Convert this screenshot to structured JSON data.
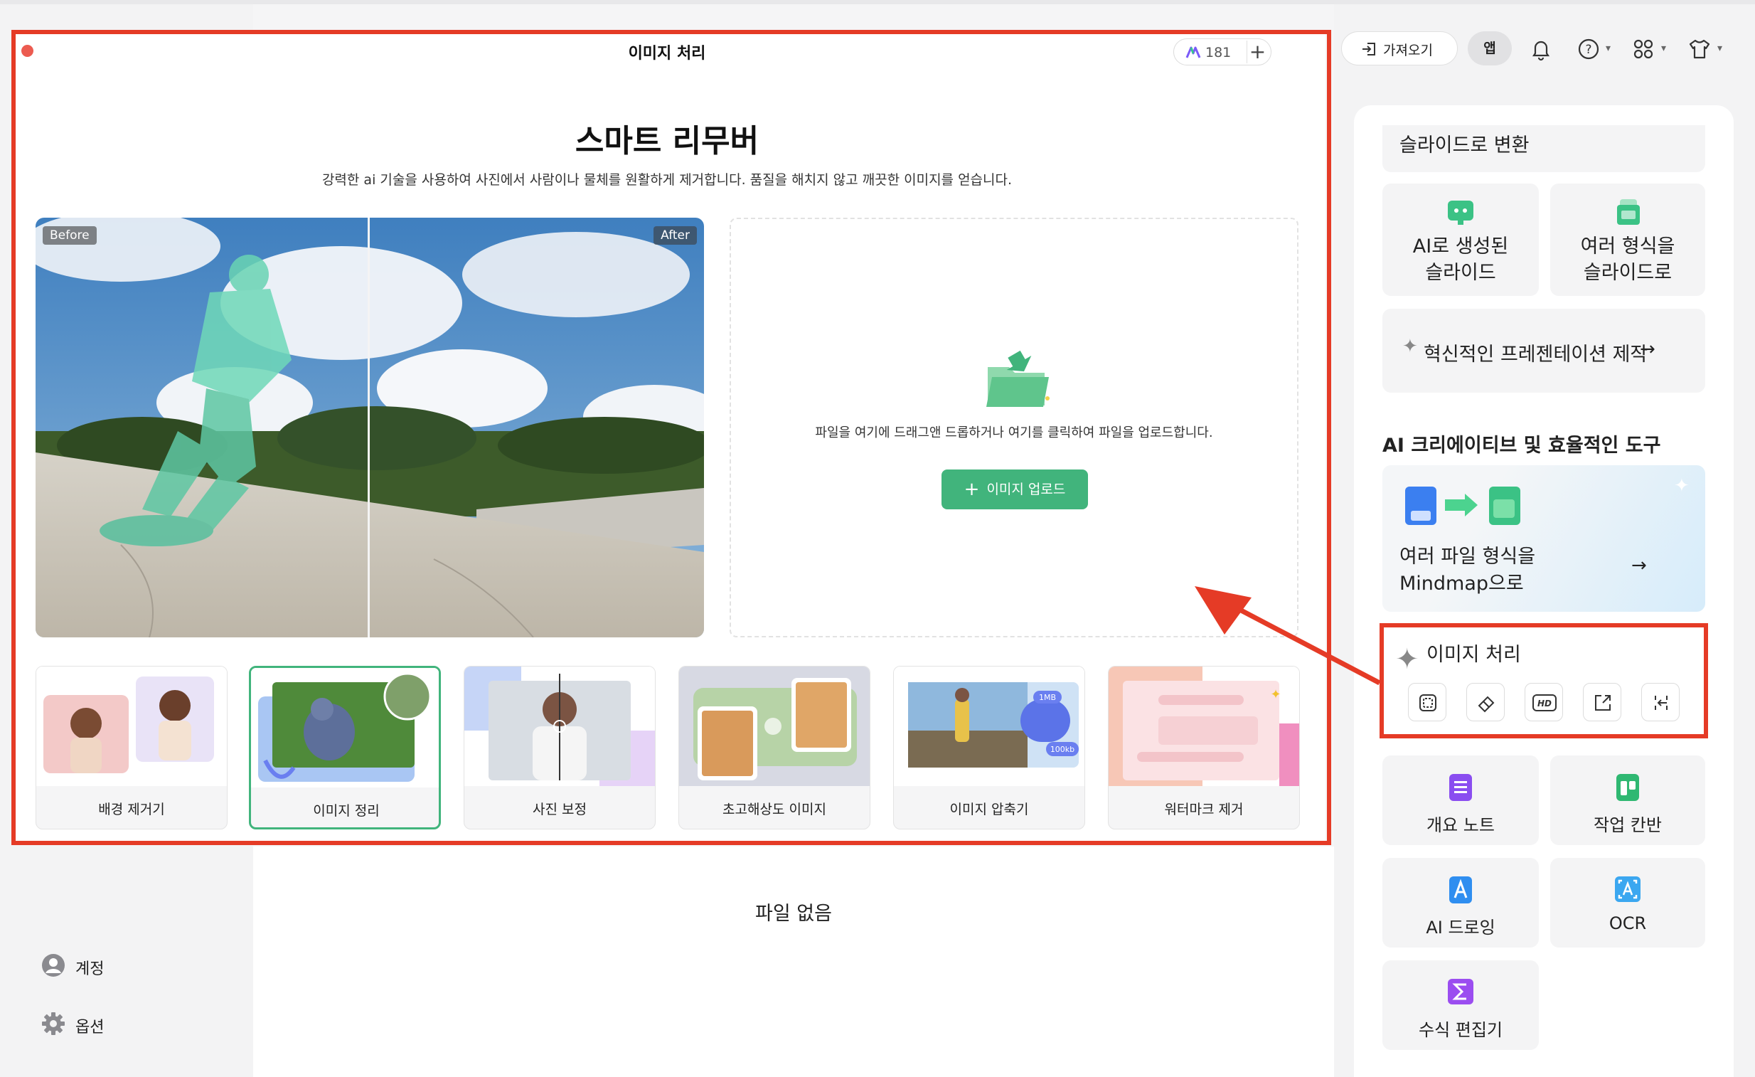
{
  "modal": {
    "title": "이미지 처리",
    "credits": "181",
    "add_symbol": "+",
    "hero_title": "스마트 리무버",
    "hero_desc": "강력한 ai 기술을 사용하여 사진에서 사람이나 물체를 원활하게 제거합니다. 품질을 해치지 않고 깨끗한 이미지를 얻습니다.",
    "before_label": "Before",
    "after_label": "After",
    "drop_text": "파일을 여기에 드래그앤 드롭하거나 여기를 클릭하여 파일을 업로드합니다.",
    "upload_label": "이미지 업로드",
    "upload_plus": "+",
    "cards": [
      {
        "label": "배경 제거기"
      },
      {
        "label": "이미지 정리"
      },
      {
        "label": "사진 보정"
      },
      {
        "label": "초고해상도 이미지"
      },
      {
        "label": "이미지 압축기"
      },
      {
        "label": "워터마크 제거"
      }
    ],
    "compress_badges": [
      "1MB",
      "100kb"
    ]
  },
  "toolbar": {
    "import_label": "가져오기",
    "app_label": "앱",
    "icons": [
      "bell-icon",
      "help-icon",
      "apps-grid-icon",
      "shirt-icon"
    ]
  },
  "sidebar": {
    "account_label": "계정",
    "options_label": "옵션"
  },
  "main": {
    "empty_text": "파일 없음"
  },
  "right_panel": {
    "slide_convert": "슬라이드로 변환",
    "ai_slides": [
      "AI로 생성된",
      "슬라이드"
    ],
    "multi_format_slides": [
      "여러 형식을",
      "슬라이드로"
    ],
    "innovative_presentation": "혁신적인 프레젠테이션 제작",
    "section_title": "AI 크리에이티브 및 효율적인 도구",
    "mindmap_label": [
      "여러 파일 형식을",
      "Mindmap으로"
    ],
    "image_processing": "이미지 처리",
    "hd_label": "HD",
    "tools": [
      {
        "label": "개요 노트"
      },
      {
        "label": "작업 칸반"
      },
      {
        "label": "AI 드로잉"
      },
      {
        "label": "OCR"
      },
      {
        "label": "수식 편집기"
      }
    ]
  },
  "colors": {
    "accent_green": "#41b47c",
    "highlight_red": "#e53b26",
    "close_dot": "#ec5b50"
  }
}
